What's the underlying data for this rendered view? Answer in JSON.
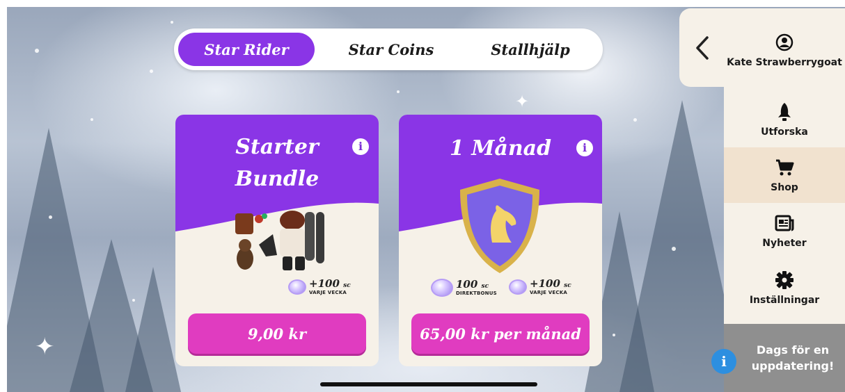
{
  "tabs": [
    {
      "label": "Star Rider",
      "active": true
    },
    {
      "label": "Star Coins",
      "active": false
    },
    {
      "label": "Stallhjälp",
      "active": false
    }
  ],
  "cards": [
    {
      "title_line1": "Starter",
      "title_line2": "Bundle",
      "info_icon": "info-icon",
      "coin_bonus": {
        "amount": "+100",
        "unit": "sc",
        "sub": "VARJE VECKA"
      },
      "price": "9,00 kr"
    },
    {
      "title": "1 Månad",
      "info_icon": "info-icon",
      "coin_bonus_direct": {
        "amount": "100",
        "unit": "sc",
        "sub": "DIREKTBONUS"
      },
      "coin_bonus_weekly": {
        "amount": "+100",
        "unit": "sc",
        "sub": "VARJE VECKA"
      },
      "price": "65,00 kr per månad"
    }
  ],
  "sidebar": {
    "back_icon": "chevron-left-icon",
    "items": [
      {
        "label": "Kate Strawberrygoat",
        "icon": "user-circle-icon",
        "active": false
      },
      {
        "label": "Utforska",
        "icon": "rocket-icon",
        "active": false
      },
      {
        "label": "Shop",
        "icon": "cart-icon",
        "active": true
      },
      {
        "label": "Nyheter",
        "icon": "newspaper-icon",
        "active": false
      },
      {
        "label": "Inställningar",
        "icon": "gear-icon",
        "active": false
      }
    ]
  },
  "update_banner": {
    "text_line1": "Dags för en",
    "text_line2": "uppdatering!",
    "icon": "info-icon"
  },
  "colors": {
    "purple": "#8a35e6",
    "pink": "#e03cc0",
    "cream": "#f6f1e8",
    "active_side": "#f1e2cf",
    "banner_gray": "#8f8f8f",
    "info_blue": "#2d8fe0"
  }
}
